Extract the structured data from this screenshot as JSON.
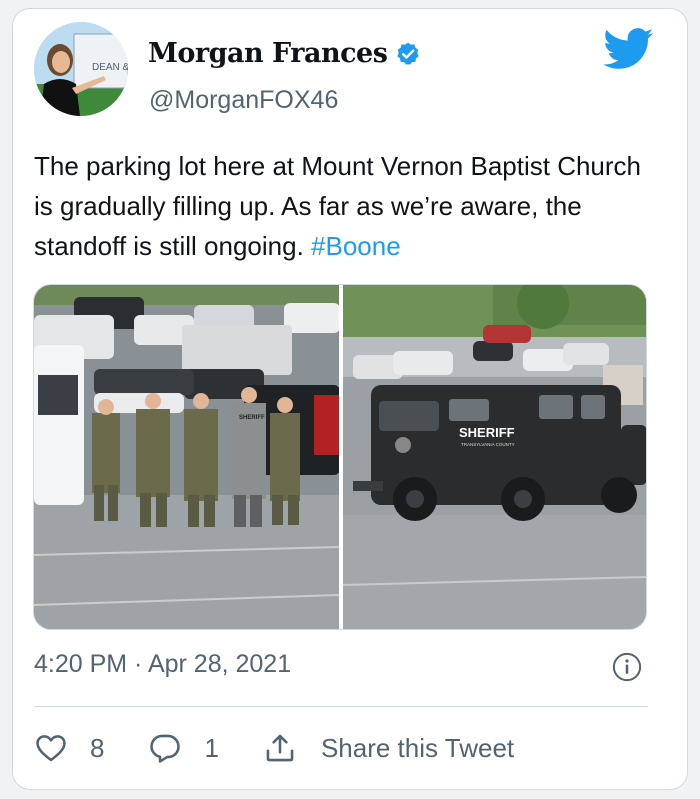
{
  "tweet": {
    "author": {
      "display_name": "Morgan Frances",
      "handle": "@MorganFOX46",
      "verified": true,
      "avatar_sign_text": "DEAN &"
    },
    "text_plain": "The parking lot here at Mount Vernon Baptist Church is gradually filling up. As far as we’re aware, the standoff is still ongoing. ",
    "hashtag": "#Boone",
    "media": [
      {
        "label": "group-of-officers-photo",
        "vehicle_text": "SHERIFF"
      },
      {
        "label": "sheriff-armored-vehicle-photo",
        "vehicle_text": "SHERIFF",
        "vehicle_subtext": "TRANSYLVANIA COUNTY"
      }
    ],
    "timestamp": "4:20 PM · Apr 28, 2021",
    "likes": "8",
    "replies": "1",
    "share_label": "Share this Tweet"
  },
  "colors": {
    "accent": "#1d9bf0",
    "text": "#0f1419",
    "secondary_text": "#536471",
    "border": "#cfd9de"
  },
  "icons": [
    "verified-badge-icon",
    "twitter-bird-icon",
    "info-icon",
    "heart-icon",
    "reply-icon",
    "share-icon"
  ]
}
